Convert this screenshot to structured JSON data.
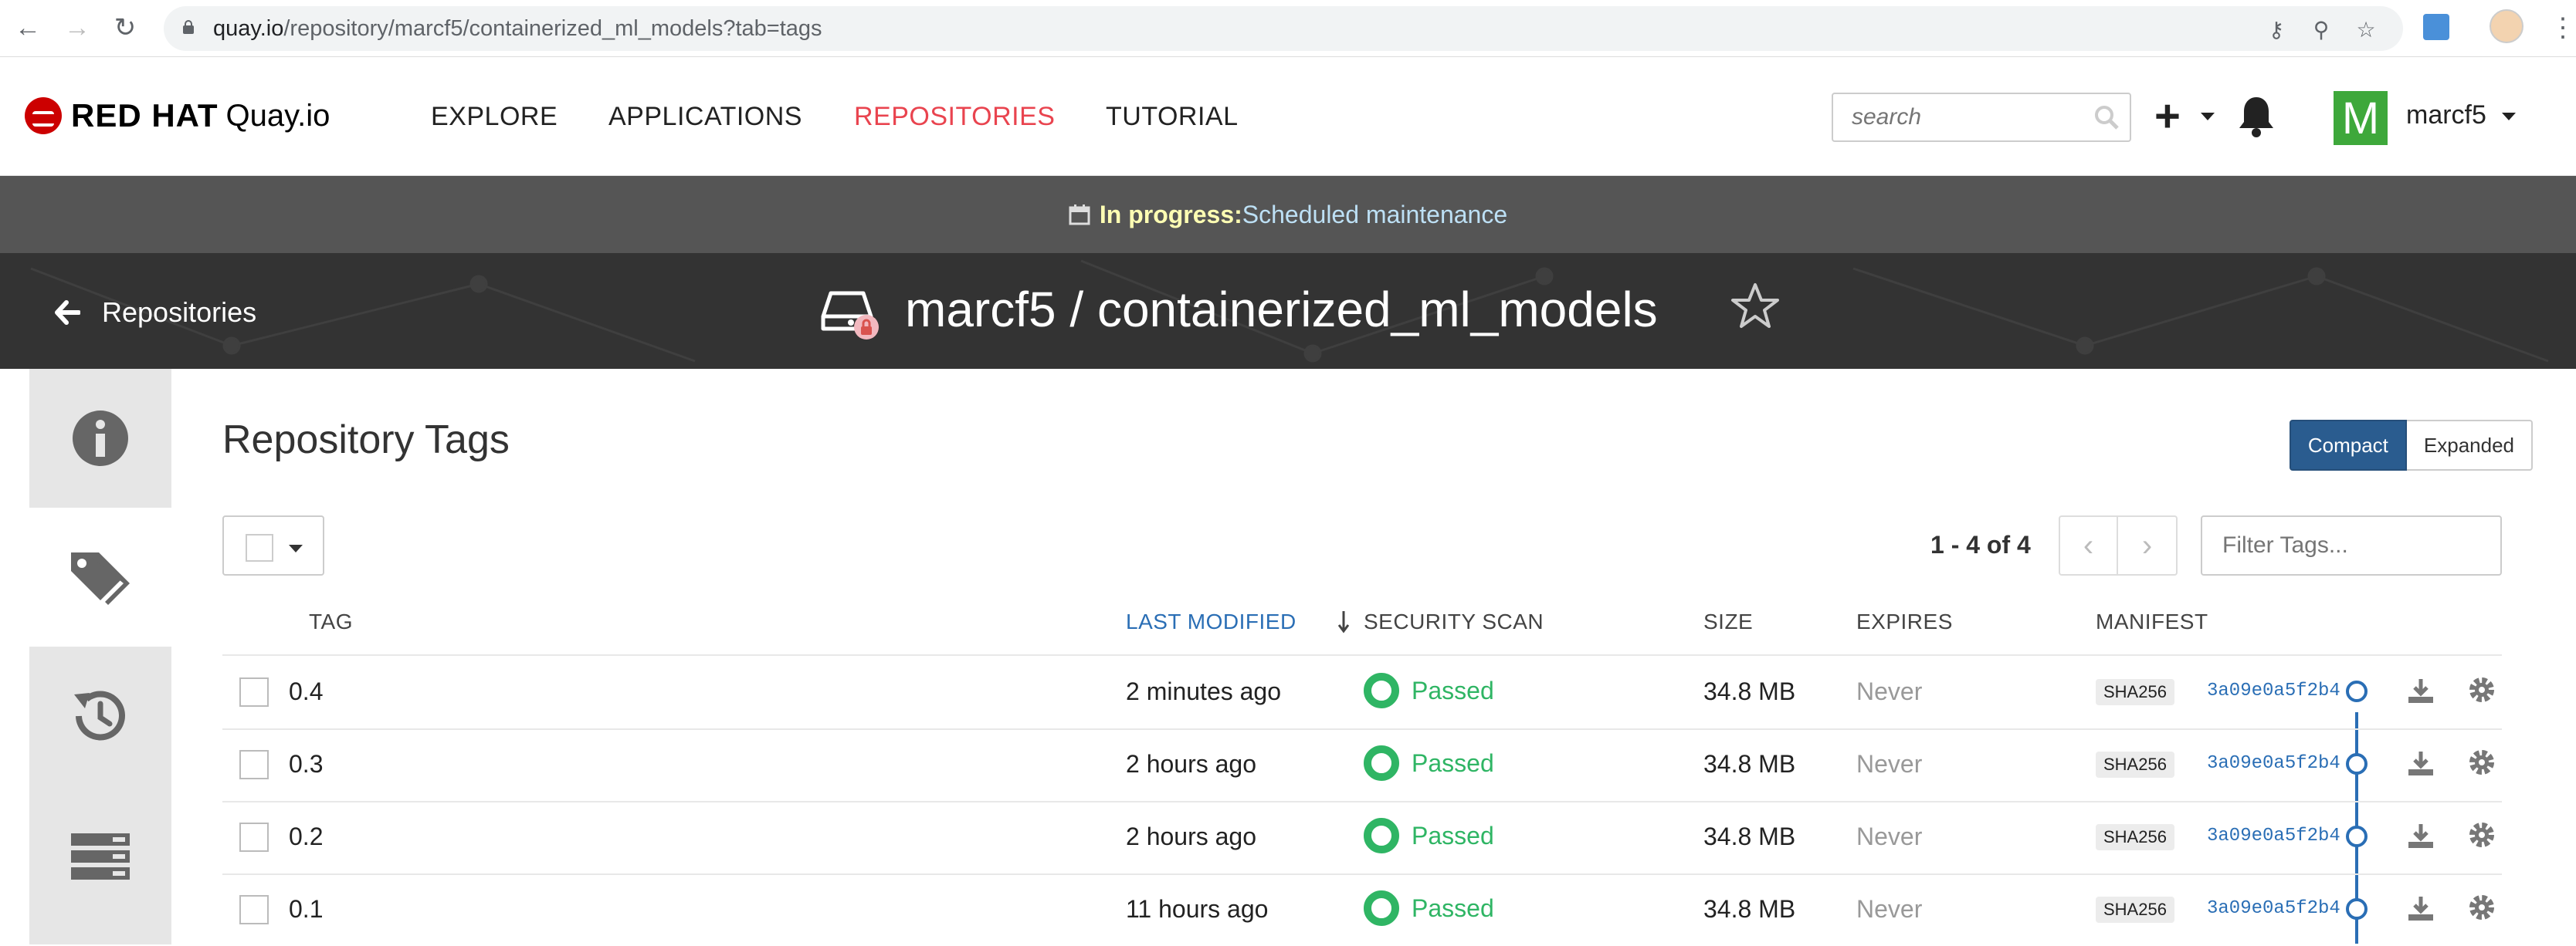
{
  "browser": {
    "url_host": "quay.io",
    "url_path": "/repository/marcf5/containerized_ml_models?tab=tags"
  },
  "header": {
    "logo_brand": "RED HAT",
    "logo_product": "Quay.io",
    "nav": [
      "EXPLORE",
      "APPLICATIONS",
      "REPOSITORIES",
      "TUTORIAL"
    ],
    "active_nav": "REPOSITORIES",
    "search_placeholder": "search",
    "username": "marcf5",
    "avatar_letter": "M"
  },
  "banner": {
    "label": "In progress:",
    "message": "Scheduled maintenance"
  },
  "repo_header": {
    "back_label": "Repositories",
    "title": "marcf5 / containerized_ml_models"
  },
  "sidenav": {
    "items": [
      "info-icon",
      "tags-icon",
      "history-icon",
      "builds-icon"
    ],
    "active": "tags-icon"
  },
  "content": {
    "title": "Repository Tags",
    "view_compact": "Compact",
    "view_expanded": "Expanded",
    "count_label": "1 - 4 of 4",
    "filter_placeholder": "Filter Tags...",
    "columns": {
      "tag": "TAG",
      "last_modified": "LAST MODIFIED",
      "security_scan": "SECURITY SCAN",
      "size": "SIZE",
      "expires": "EXPIRES",
      "manifest": "MANIFEST"
    },
    "rows": [
      {
        "tag": "0.4",
        "modified": "2 minutes ago",
        "scan": "Passed",
        "size": "34.8 MB",
        "expires": "Never",
        "sha": "SHA256",
        "digest": "3a09e0a5f2b4"
      },
      {
        "tag": "0.3",
        "modified": "2 hours ago",
        "scan": "Passed",
        "size": "34.8 MB",
        "expires": "Never",
        "sha": "SHA256",
        "digest": "3a09e0a5f2b4"
      },
      {
        "tag": "0.2",
        "modified": "2 hours ago",
        "scan": "Passed",
        "size": "34.8 MB",
        "expires": "Never",
        "sha": "SHA256",
        "digest": "3a09e0a5f2b4"
      },
      {
        "tag": "0.1",
        "modified": "11 hours ago",
        "scan": "Passed",
        "size": "34.8 MB",
        "expires": "Never",
        "sha": "SHA256",
        "digest": "3a09e0a5f2b4"
      }
    ]
  },
  "colors": {
    "accent_red": "#e9444f",
    "link_blue": "#2a6eb5",
    "passed_green": "#2fb564",
    "compact_blue": "#2a5c8f"
  }
}
